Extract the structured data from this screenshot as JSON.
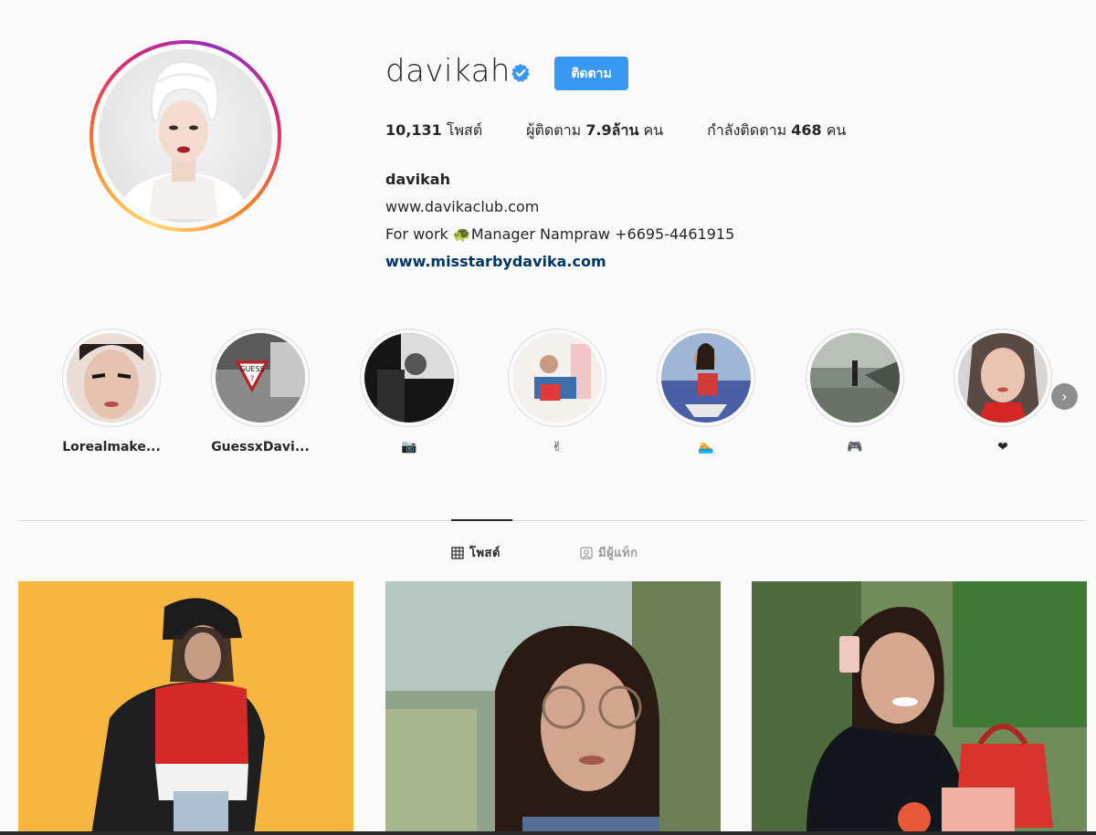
{
  "profile": {
    "username": "davikah",
    "follow_label": "ติดตาม",
    "stats": {
      "posts_count": "10,131",
      "posts_label": "โพสต์",
      "followers_label": "ผู้ติดตาม",
      "followers_count": "7.9ล้าน",
      "followers_unit": "คน",
      "following_label": "กำลังติดตาม",
      "following_count": "468",
      "following_unit": "คน"
    },
    "bio": {
      "name": "davikah",
      "line1": "www.davikaclub.com",
      "line2": "For work 🐢Manager Nampraw +6695-4461915",
      "link": "www.misstarbydavika.com"
    }
  },
  "highlights": [
    {
      "label": "Lorealmake..."
    },
    {
      "label": "GuessxDavi..."
    },
    {
      "label": "📷"
    },
    {
      "label": "✌"
    },
    {
      "label": "🏊"
    },
    {
      "label": "🎮"
    },
    {
      "label": "❤"
    }
  ],
  "tabs": {
    "posts": "โพสต์",
    "tagged": "มีผู้แท็ก"
  },
  "colors": {
    "follow_button": "#3897f0",
    "verified_badge": "#3897f0",
    "link": "#003569"
  }
}
